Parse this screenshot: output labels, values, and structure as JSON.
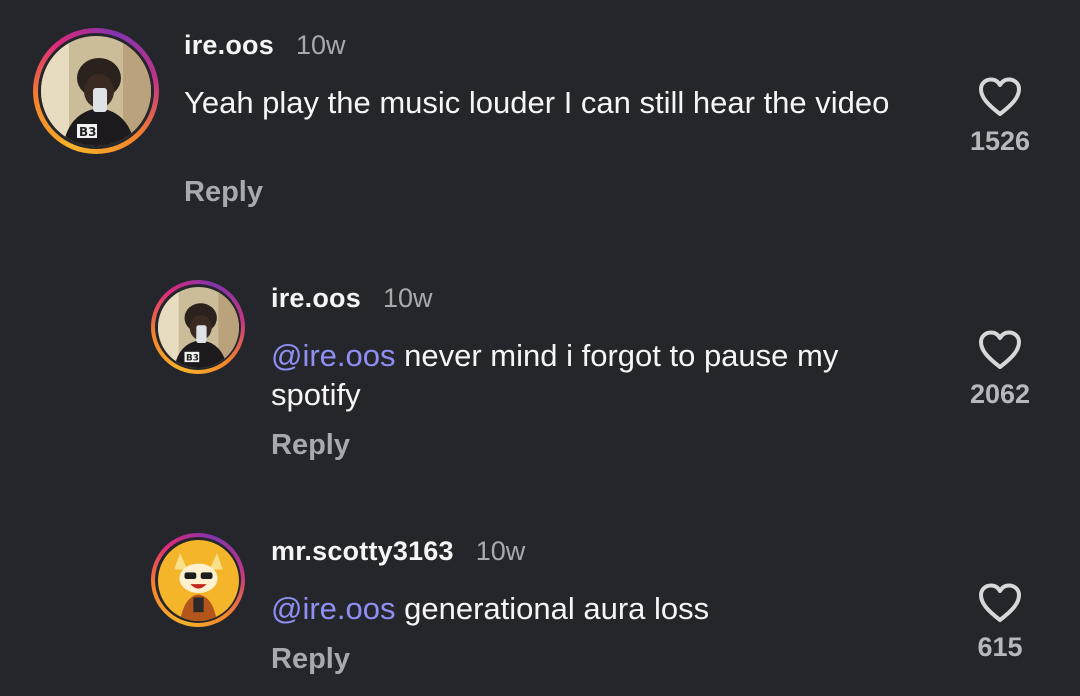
{
  "comments": [
    {
      "username": "ire.oos",
      "time": "10w",
      "mention": "",
      "text": "Yeah play the music louder I can still hear the video",
      "reply_label": "Reply",
      "likes": "1526",
      "avatar": "avatar-person-selfie"
    },
    {
      "username": "ire.oos",
      "time": "10w",
      "mention": "@ire.oos",
      "text": " never mind i forgot to pause my spotify",
      "reply_label": "Reply",
      "likes": "2062",
      "avatar": "avatar-person-selfie"
    },
    {
      "username": "mr.scotty3163",
      "time": "10w",
      "mention": "@ire.oos",
      "text": " generational aura loss",
      "reply_label": "Reply",
      "likes": "615",
      "avatar": "avatar-cartoon-character"
    }
  ],
  "colors": {
    "background": "#25262b",
    "mention": "#8f8ff3",
    "secondary_text": "#a8a9ae"
  },
  "icons": {
    "like": "heart-outline-icon"
  }
}
